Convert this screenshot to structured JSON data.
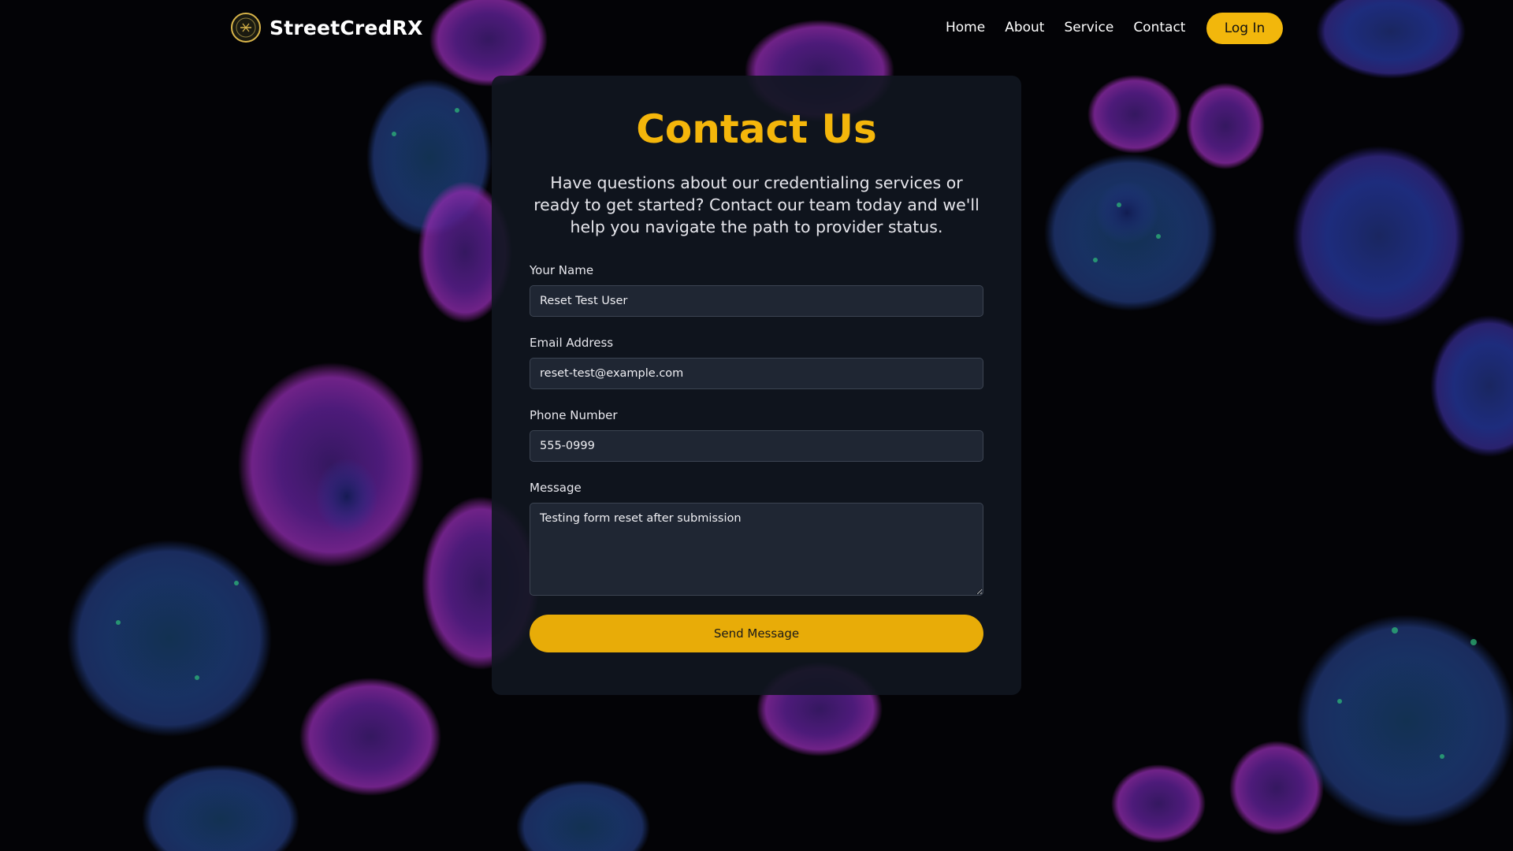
{
  "header": {
    "brand_name": "StreetCredRX",
    "logo_icon": "crosshair-logo-icon",
    "nav": {
      "home": "Home",
      "about": "About",
      "service": "Service",
      "contact": "Contact"
    },
    "login_label": "Log In"
  },
  "contact": {
    "title": "Contact Us",
    "intro": "Have questions about our credentialing services or ready to get started? Contact our team today and we'll help you navigate the path to provider status.",
    "fields": {
      "name": {
        "label": "Your Name",
        "value": "Reset Test User"
      },
      "email": {
        "label": "Email Address",
        "value": "reset-test@example.com"
      },
      "phone": {
        "label": "Phone Number",
        "value": "555-0999"
      },
      "message": {
        "label": "Message",
        "value": "Testing form reset after submission"
      }
    },
    "submit_label": "Send Message"
  },
  "colors": {
    "accent": "#f2b70c",
    "page_background": "#030306",
    "card_background": "#111620",
    "input_background": "#1f2633"
  }
}
